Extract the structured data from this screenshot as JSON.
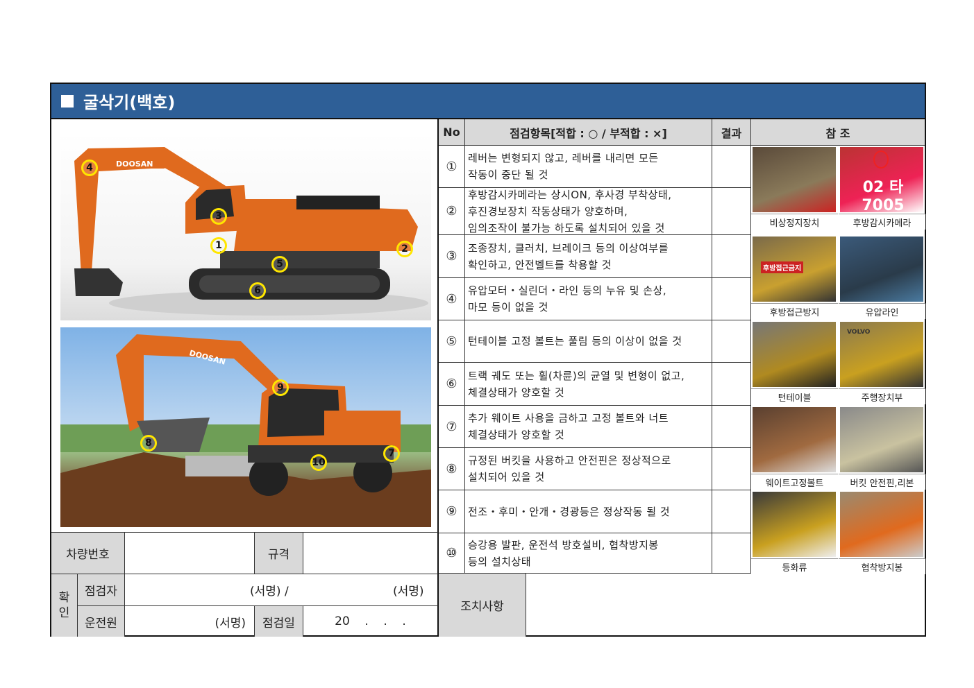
{
  "header": {
    "title": "굴삭기(백호)"
  },
  "table": {
    "col_no": "No",
    "col_item": "점검항목[적합 : ○ / 부적합 : ×]",
    "col_result": "결과",
    "col_ref": "참 조",
    "rows": [
      {
        "no": "①",
        "text": "레버는 변형되지 않고, 레버를 내리면 모든\n작동이 중단 될 것"
      },
      {
        "no": "②",
        "text": "후방감시카메라는 상시ON, 후사경 부착상태,\n후진경보장치 작동상태가 양호하며,\n임의조작이 불가능 하도록 설치되어 있을 것"
      },
      {
        "no": "③",
        "text": "조종장치, 클러치, 브레이크 등의 이상여부를\n확인하고, 안전벨트를 착용할 것"
      },
      {
        "no": "④",
        "text": "유압모터・실린더・라인 등의 누유 및 손상,\n마모 등이 없을 것"
      },
      {
        "no": "⑤",
        "text": "턴테이블 고정 볼트는 풀림 등의 이상이 없을 것"
      },
      {
        "no": "⑥",
        "text": "트랙 궤도 또는 휠(차륜)의 균열 및 변형이 없고,\n체결상태가 양호할 것"
      },
      {
        "no": "⑦",
        "text": "추가 웨이트 사용을 금하고 고정 볼트와 너트\n체결상태가 양호할 것"
      },
      {
        "no": "⑧",
        "text": "규정된 버킷을 사용하고 안전핀은 정상적으로\n설치되어 있을 것"
      },
      {
        "no": "⑨",
        "text": "전조・후미・안개・경광등은 정상작동 될 것"
      },
      {
        "no": "⑩",
        "text": "승강용 발판, 운전석 방호설비, 협착방지봉\n등의 설치상태"
      }
    ]
  },
  "references": [
    {
      "left": "비상정지장치",
      "right": "후방감시카메라",
      "plate_text": "02 타 7005"
    },
    {
      "left": "후방접근방지",
      "right": "유압라인",
      "sign_text": "후방접근금지"
    },
    {
      "left": "턴테이블",
      "right": "주행장치부",
      "brand_text": "VOLVO"
    },
    {
      "left": "웨이트고정볼트",
      "right": "버킷 안전핀,리본"
    },
    {
      "left": "등화류",
      "right": "협착방지봉"
    }
  ],
  "photo_badges": [
    "4",
    "3",
    "1",
    "2",
    "5",
    "6",
    "9",
    "8",
    "10",
    "7"
  ],
  "photo_brand": "DOOSAN",
  "info": {
    "vehicle_no_label": "차량번호",
    "spec_label": "규격",
    "confirm_label": "확\n인",
    "inspector_label": "점검자",
    "inspector_sign": "(서명) /",
    "inspector_sign2": "(서명)",
    "driver_label": "운전원",
    "driver_sign": "(서명)",
    "date_label": "점검일",
    "date_value": "20    .    .    .",
    "action_label": "조치사항"
  },
  "colors": {
    "header_bg": "#2e5f97",
    "cell_grey": "#d9d9d9",
    "excavator_orange": "#e06a1e",
    "badge_yellow": "#ffe600"
  }
}
